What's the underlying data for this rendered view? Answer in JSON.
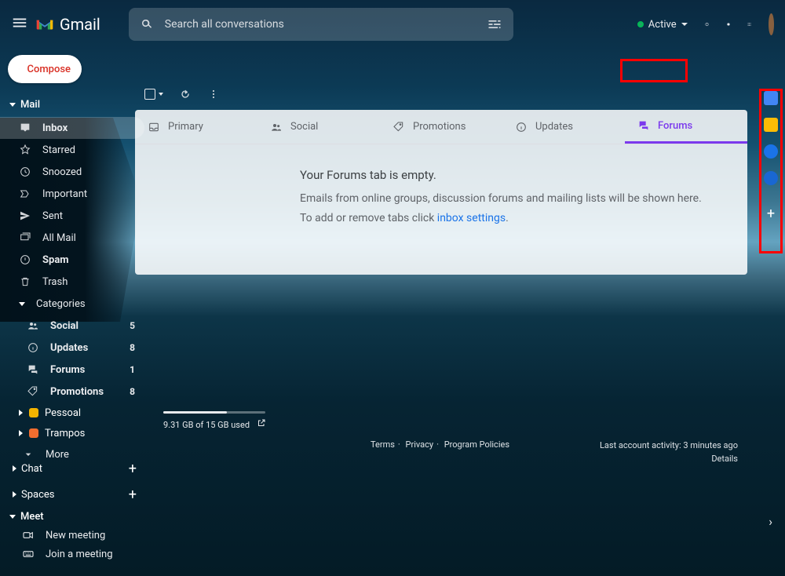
{
  "header": {
    "brand": "Gmail",
    "search_placeholder": "Search all conversations",
    "status_label": "Active"
  },
  "compose_label": "Compose",
  "sections": {
    "mail": "Mail",
    "chat": "Chat",
    "spaces": "Spaces",
    "meet": "Meet"
  },
  "nav": {
    "inbox": "Inbox",
    "starred": "Starred",
    "snoozed": "Snoozed",
    "important": "Important",
    "sent": "Sent",
    "allmail": "All Mail",
    "spam": "Spam",
    "trash": "Trash",
    "categories": "Categories",
    "more": "More"
  },
  "categories": {
    "social": {
      "label": "Social",
      "count": "5"
    },
    "updates": {
      "label": "Updates",
      "count": "8"
    },
    "forums": {
      "label": "Forums",
      "count": "1"
    },
    "promotions": {
      "label": "Promotions",
      "count": "8"
    }
  },
  "labels": {
    "pessoal": "Pessoal",
    "trampos": "Trampos"
  },
  "meet": {
    "new": "New meeting",
    "join": "Join a meeting"
  },
  "tabs": {
    "primary": "Primary",
    "social": "Social",
    "promotions": "Promotions",
    "updates": "Updates",
    "forums": "Forums"
  },
  "empty": {
    "title": "Your Forums tab is empty.",
    "line1": "Emails from online groups, discussion forums and mailing lists will be shown here.",
    "line2_prefix": "To add or remove tabs click ",
    "line2_link": "inbox settings",
    "line2_suffix": "."
  },
  "storage": {
    "text": "9.31 GB of 15 GB used"
  },
  "footer": {
    "terms": "Terms",
    "privacy": "Privacy",
    "policies": "Program Policies",
    "activity": "Last account activity: 3 minutes ago",
    "details": "Details"
  }
}
